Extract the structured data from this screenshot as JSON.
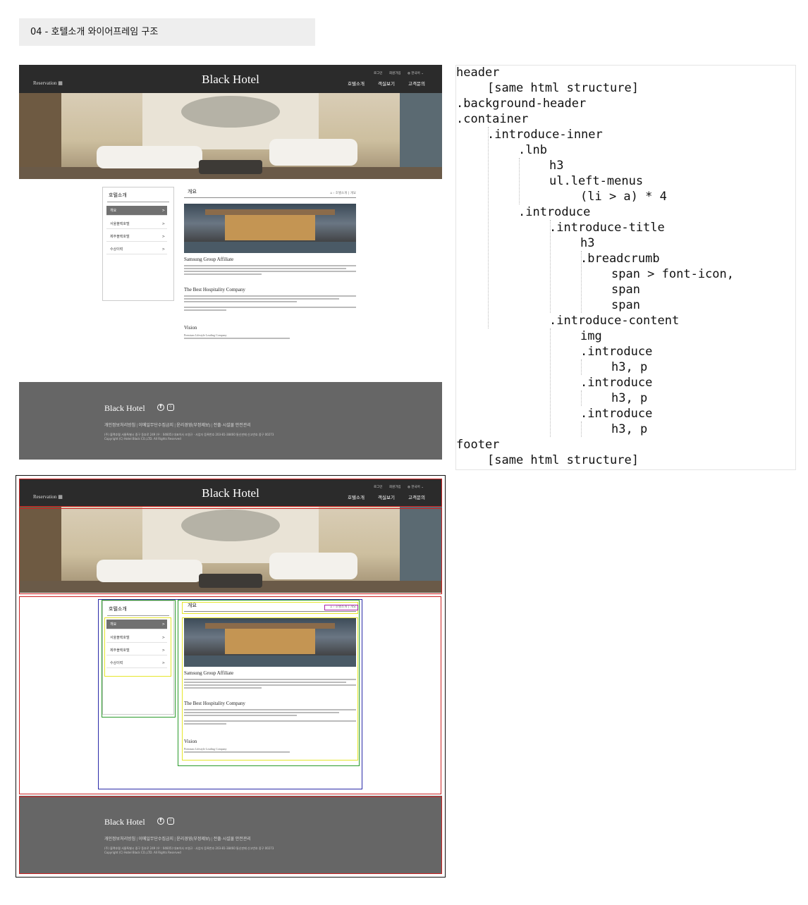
{
  "title": "04 - 호텔소개 와이어프레임 구조",
  "site": {
    "reservation": "Reservation",
    "brand": "Black Hotel",
    "util": {
      "login": "로그인",
      "join": "회원가입",
      "lang": "한국어"
    },
    "nav": [
      "호텔소개",
      "객실보기",
      "고객문의"
    ]
  },
  "lnb": {
    "title": "호텔소개",
    "items": [
      {
        "label": "개요",
        "active": true
      },
      {
        "label": "서울블랙호텔"
      },
      {
        "label": "제주블랙호텔"
      },
      {
        "label": "수상이력"
      }
    ],
    "arrow": ">"
  },
  "intro": {
    "title": "개요",
    "breadcrumb": [
      "호텔소개",
      "개요"
    ],
    "sections": [
      {
        "heading": "Samsung Group Affiliate"
      },
      {
        "heading": "The Best Hospitality Company"
      },
      {
        "heading": "Vision",
        "sub": "Premium Lifestyle Leading Company"
      }
    ]
  },
  "footer": {
    "brand": "Black Hotel",
    "links": "개인정보처리방침 | 이메일무단수집금지 | 윤리경영(부정제보) | 전출·시설물 안전관리",
    "address": "(주) 블랙호텔 서울특별시 중구 동호로 249 (우 : 04605) 대표이사 조영규 · 사업자 등록번호 203-81-38460 통신판매 신고번호 중구 00273",
    "copyright": "Copyright (C) Hotel Black CO.,LTD. All Rights Reserved"
  },
  "code": [
    {
      "text": "header",
      "indent": 0
    },
    {
      "text": "[same html structure]",
      "indent": 1
    },
    {
      "text": ".background-header",
      "indent": 0
    },
    {
      "text": ".container",
      "indent": 0
    },
    {
      "text": ".introduce-inner",
      "indent": 1
    },
    {
      "text": ".lnb",
      "indent": 2
    },
    {
      "text": "h3",
      "indent": 3
    },
    {
      "text": "ul.left-menus",
      "indent": 3
    },
    {
      "text": "(li > a) * 4",
      "indent": 4
    },
    {
      "text": ".introduce",
      "indent": 2
    },
    {
      "text": ".introduce-title",
      "indent": 3
    },
    {
      "text": "h3",
      "indent": 4
    },
    {
      "text": ".breadcrumb",
      "indent": 4
    },
    {
      "text": "span > font-icon,",
      "indent": 5
    },
    {
      "text": "span",
      "indent": 5
    },
    {
      "text": "span",
      "indent": 5
    },
    {
      "text": ".introduce-content",
      "indent": 3
    },
    {
      "text": "img",
      "indent": 4
    },
    {
      "text": ".introduce",
      "indent": 4
    },
    {
      "text": "h3, p",
      "indent": 5
    },
    {
      "text": ".introduce",
      "indent": 4
    },
    {
      "text": "h3, p",
      "indent": 5
    },
    {
      "text": ".introduce",
      "indent": 4
    },
    {
      "text": "h3, p",
      "indent": 5
    },
    {
      "text": "footer",
      "indent": 0
    },
    {
      "text": "[same html structure]",
      "indent": 1
    }
  ],
  "colors": {
    "header_bg": "#2b2b2b",
    "footer_bg": "#666666",
    "box_red": "#cc2222",
    "box_blue": "#2a2aa8",
    "box_green": "#2a9a2a",
    "box_yellow": "#e6e62a",
    "box_purple": "#aa22aa"
  }
}
